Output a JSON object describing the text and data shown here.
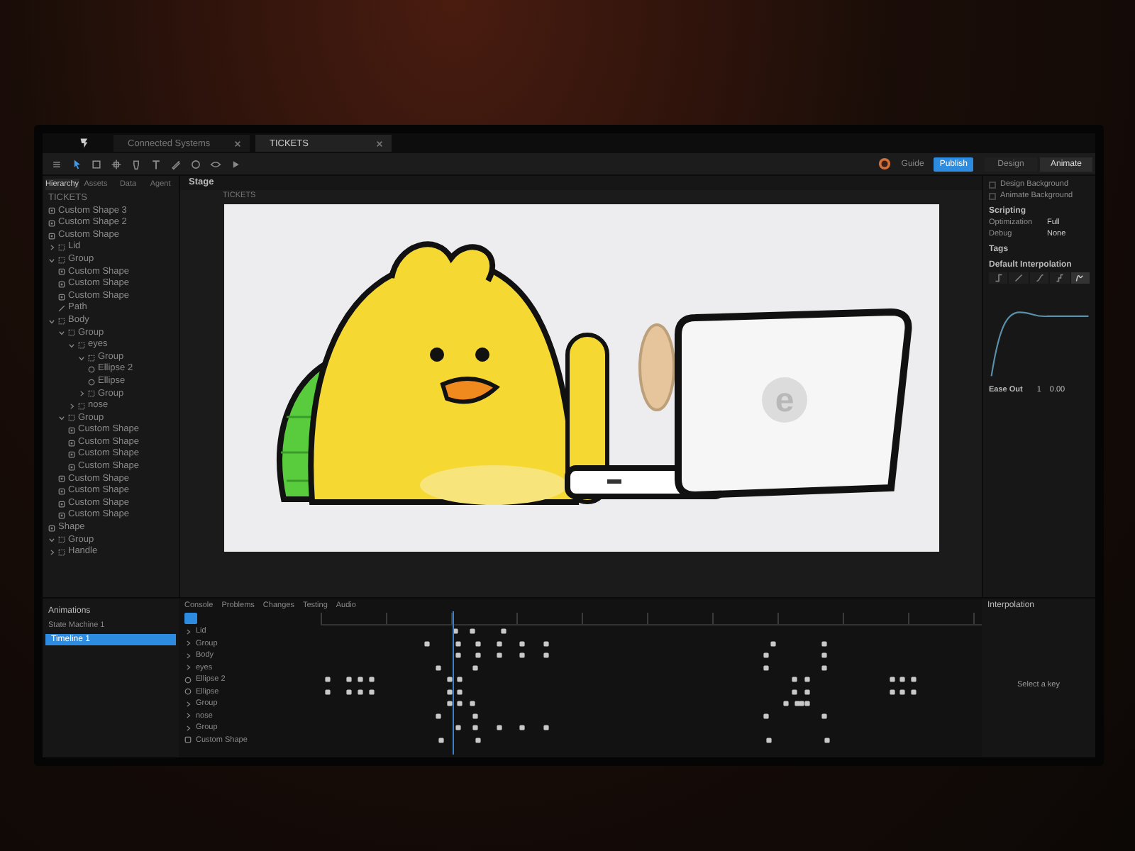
{
  "file_tabs": [
    {
      "label": "Connected Systems",
      "selected": false
    },
    {
      "label": "TICKETS",
      "selected": true
    }
  ],
  "toolbar": {
    "guide_button": "Guide",
    "publish_button": "Publish"
  },
  "mode_tabs": [
    {
      "label": "Design",
      "selected": false
    },
    {
      "label": "Animate",
      "selected": true
    }
  ],
  "left_tabs": [
    {
      "label": "Hierarchy",
      "selected": true
    },
    {
      "label": "Assets",
      "selected": false
    },
    {
      "label": "Data",
      "selected": false
    },
    {
      "label": "Agent",
      "selected": false
    }
  ],
  "hierarchy": {
    "root": "TICKETS",
    "items": [
      {
        "label": "Custom Shape 3",
        "kind": "shape"
      },
      {
        "label": "Custom Shape 2",
        "kind": "shape"
      },
      {
        "label": "Custom Shape",
        "kind": "shape"
      },
      {
        "label": "Lid",
        "kind": "group",
        "expanded": false
      },
      {
        "label": "Group",
        "kind": "group",
        "expanded": true,
        "children": [
          {
            "label": "Custom Shape",
            "kind": "shape"
          },
          {
            "label": "Custom Shape",
            "kind": "shape"
          },
          {
            "label": "Custom Shape",
            "kind": "shape"
          },
          {
            "label": "Path",
            "kind": "path"
          }
        ]
      },
      {
        "label": "Body",
        "kind": "group",
        "expanded": true,
        "children": [
          {
            "label": "Group",
            "kind": "group",
            "expanded": true,
            "children": [
              {
                "label": "eyes",
                "kind": "group",
                "expanded": true,
                "children": [
                  {
                    "label": "Group",
                    "kind": "group",
                    "expanded": true,
                    "children": [
                      {
                        "label": "Ellipse 2",
                        "kind": "ellipse"
                      },
                      {
                        "label": "Ellipse",
                        "kind": "ellipse"
                      }
                    ]
                  },
                  {
                    "label": "Group",
                    "kind": "group",
                    "expanded": false
                  }
                ]
              },
              {
                "label": "nose",
                "kind": "group",
                "expanded": false
              }
            ]
          },
          {
            "label": "Group",
            "kind": "group",
            "expanded": true,
            "children": [
              {
                "label": "Custom Shape",
                "kind": "shape"
              },
              {
                "label": "Custom Shape",
                "kind": "shape"
              },
              {
                "label": "Custom Shape",
                "kind": "shape"
              },
              {
                "label": "Custom Shape",
                "kind": "shape"
              }
            ]
          },
          {
            "label": "Custom Shape",
            "kind": "shape"
          },
          {
            "label": "Custom Shape",
            "kind": "shape"
          },
          {
            "label": "Custom Shape",
            "kind": "shape"
          },
          {
            "label": "Custom Shape",
            "kind": "shape"
          }
        ]
      },
      {
        "label": "Shape",
        "kind": "shape"
      },
      {
        "label": "Group",
        "kind": "group",
        "expanded": true
      },
      {
        "label": "Handle",
        "kind": "group",
        "expanded": false
      }
    ]
  },
  "stage": {
    "title": "Stage",
    "breadcrumb": "TICKETS",
    "laptop_logo": "e"
  },
  "right_panel": {
    "options": [
      {
        "label": "Design Background",
        "checked": false
      },
      {
        "label": "Animate Background",
        "checked": false
      }
    ],
    "scripting": "Scripting",
    "settings": [
      {
        "label": "Optimization",
        "value": "Full"
      },
      {
        "label": "Debug",
        "value": "None"
      }
    ],
    "tags": "Tags",
    "interpolation_title": "Default Interpolation",
    "interpolation_options": [
      {
        "kind": "hold",
        "selected": false
      },
      {
        "kind": "linear",
        "selected": false
      },
      {
        "kind": "ease",
        "selected": false
      },
      {
        "kind": "step",
        "selected": false
      },
      {
        "kind": "elastic",
        "selected": true
      }
    ],
    "curve_name": "Ease Out",
    "value_1": "1",
    "value_2": "0.00"
  },
  "bottom_tabs": [
    "Console",
    "Problems",
    "Changes",
    "Testing",
    "Audio"
  ],
  "animations": {
    "title": "Animations",
    "state_machine": "State Machine 1",
    "timelines": [
      {
        "label": "Timeline 1",
        "selected": true
      }
    ]
  },
  "timeline": {
    "rows": [
      {
        "label": "Lid",
        "kind": "group"
      },
      {
        "label": "Group",
        "kind": "group"
      },
      {
        "label": "Body",
        "kind": "group"
      },
      {
        "label": "eyes",
        "kind": "group"
      },
      {
        "label": "Ellipse 2",
        "kind": "ellipse"
      },
      {
        "label": "Ellipse",
        "kind": "ellipse"
      },
      {
        "label": "Group",
        "kind": "group"
      },
      {
        "label": "nose",
        "kind": "group"
      },
      {
        "label": "Group",
        "kind": "group"
      },
      {
        "label": "Custom Shape",
        "kind": "shape"
      }
    ]
  },
  "interpolation_panel": {
    "title": "Interpolation",
    "empty_text": "Select a key"
  }
}
